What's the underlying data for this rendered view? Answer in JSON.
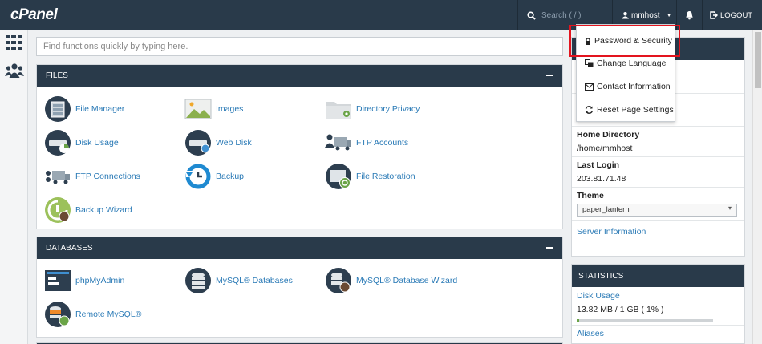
{
  "app": {
    "logo": "cPanel"
  },
  "header": {
    "search_placeholder": "Search ( / )",
    "username": "mmhost",
    "logout_label": "LOGOUT"
  },
  "quick_search": {
    "placeholder": "Find functions quickly by typing here."
  },
  "files": {
    "title": "FILES",
    "items": [
      {
        "label": "File Manager",
        "icon": "file-manager-icon"
      },
      {
        "label": "Images",
        "icon": "images-icon"
      },
      {
        "label": "Directory Privacy",
        "icon": "folder-privacy-icon"
      },
      {
        "label": "Disk Usage",
        "icon": "disk-usage-icon"
      },
      {
        "label": "Web Disk",
        "icon": "web-disk-icon"
      },
      {
        "label": "FTP Accounts",
        "icon": "ftp-accounts-icon"
      },
      {
        "label": "FTP Connections",
        "icon": "ftp-connections-icon"
      },
      {
        "label": "Backup",
        "icon": "backup-icon"
      },
      {
        "label": "File Restoration",
        "icon": "file-restoration-icon"
      },
      {
        "label": "Backup Wizard",
        "icon": "backup-wizard-icon"
      }
    ]
  },
  "databases": {
    "title": "DATABASES",
    "items": [
      {
        "label": "phpMyAdmin",
        "icon": "phpmyadmin-icon"
      },
      {
        "label": "MySQL® Databases",
        "icon": "mysql-databases-icon"
      },
      {
        "label": "MySQL® Database Wizard",
        "icon": "mysql-wizard-icon"
      },
      {
        "label": "Remote MySQL®",
        "icon": "remote-mysql-icon"
      }
    ]
  },
  "user_menu": {
    "items": [
      {
        "label": "Password & Security",
        "icon": "lock-icon"
      },
      {
        "label": "Change Language",
        "icon": "language-icon"
      },
      {
        "label": "Contact Information",
        "icon": "envelope-icon"
      },
      {
        "label": "Reset Page Settings",
        "icon": "refresh-icon"
      }
    ]
  },
  "general_info": {
    "home_directory_label": "Home Directory",
    "home_directory_value": "/home/mmhost",
    "last_login_label": "Last Login",
    "last_login_value": "203.81.71.48",
    "theme_label": "Theme",
    "theme_value": "paper_lantern",
    "server_info_link": "Server Information"
  },
  "statistics": {
    "title": "STATISTICS",
    "disk_usage_label": "Disk Usage",
    "disk_usage_value": "13.82 MB / 1 GB ( 1% )",
    "disk_usage_fraction": 0.01,
    "aliases_label": "Aliases"
  },
  "colors": {
    "header": "#293a4a",
    "link": "#2a7ab6",
    "highlight": "#e3141e"
  }
}
